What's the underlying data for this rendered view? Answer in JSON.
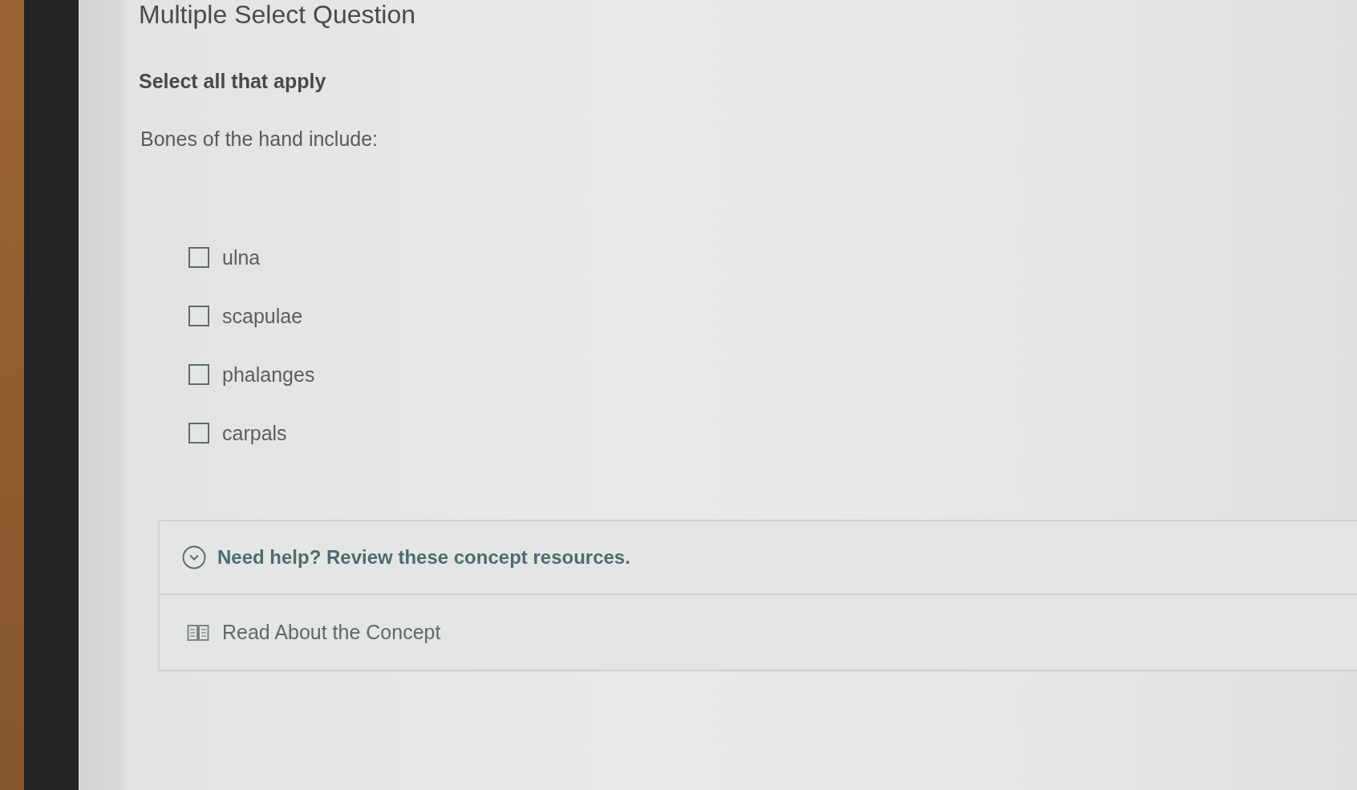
{
  "question": {
    "type_label": "Multiple Select Question",
    "instruction": "Select all that apply",
    "prompt": "Bones of the hand include:"
  },
  "options": [
    {
      "label": "ulna",
      "checked": false
    },
    {
      "label": "scapulae",
      "checked": false
    },
    {
      "label": "phalanges",
      "checked": false
    },
    {
      "label": "carpals",
      "checked": false
    }
  ],
  "help": {
    "title": "Need help? Review these concept resources.",
    "expanded": true,
    "resources": [
      {
        "label": "Read About the Concept"
      }
    ]
  }
}
